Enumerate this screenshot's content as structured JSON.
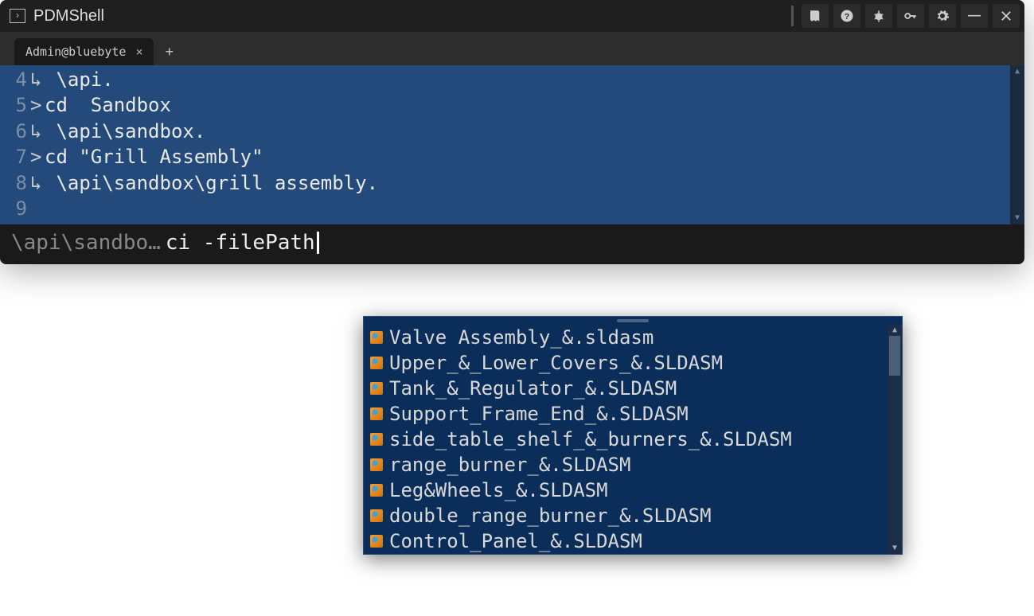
{
  "title": "PDMShell",
  "tab": {
    "label": "Admin@bluebyte"
  },
  "terminal_lines": [
    {
      "n": "4",
      "marker": "↳",
      "text": " \\api."
    },
    {
      "n": "5",
      "marker": ">",
      "text": "cd  Sandbox"
    },
    {
      "n": "6",
      "marker": "↳",
      "text": " \\api\\sandbox."
    },
    {
      "n": "7",
      "marker": ">",
      "text": "cd \"Grill Assembly\""
    },
    {
      "n": "8",
      "marker": "↳",
      "text": " \\api\\sandbox\\grill assembly."
    },
    {
      "n": "9",
      "marker": "",
      "text": ""
    }
  ],
  "prompt": {
    "path": "\\api\\sandbo…",
    "command": "ci -filePath "
  },
  "autocomplete_items": [
    "Valve Assembly_&.sldasm",
    "Upper_&_Lower_Covers_&.SLDASM",
    "Tank_&_Regulator_&.SLDASM",
    "Support_Frame_End_&.SLDASM",
    "side_table_shelf_&_burners_&.SLDASM",
    "range_burner_&.SLDASM",
    "Leg&Wheels_&.SLDASM",
    "double_range_burner_&.SLDASM",
    "Control_Panel_&.SLDASM"
  ]
}
